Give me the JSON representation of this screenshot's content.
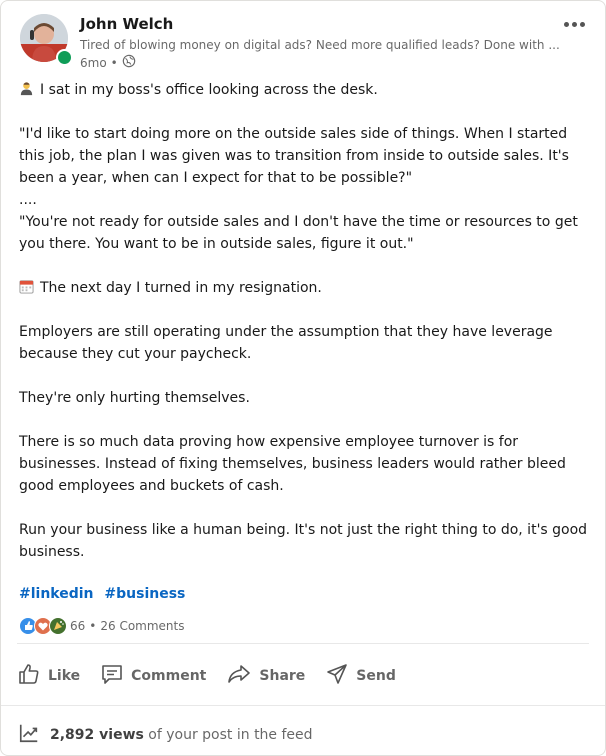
{
  "post": {
    "author_name": "John Welch",
    "author_headline": "Tired of blowing money on digital ads? Need more qualified leads? Done with ...",
    "age": "6mo",
    "meta_separator": "•",
    "body_paragraphs": [
      "I sat in my boss's office looking across the desk.",
      "\"I'd like to start doing more on the outside sales side of things. When I started this job, the plan I was given was to transition from inside to outside sales. It's been a year, when can I expect for that to be possible?\"",
      "....",
      "\"You're not ready for outside sales and I don't have the time or resources to get you there. You want to be in outside sales, figure it out.\"",
      "The next day I turned in my resignation.",
      "Employers are still operating under the assumption that they have leverage because they cut your paycheck.",
      "They're only hurting themselves.",
      "There is so much data proving how expensive employee turnover is for businesses. Instead of fixing themselves, business leaders would rather bleed good employees and buckets of cash.",
      "Run your business like a human being. It's not just the right thing to do, it's good business."
    ],
    "hashtags": [
      "#linkedin",
      "#business"
    ]
  },
  "social": {
    "reaction_count": "66",
    "separator": "•",
    "comments": "26 Comments",
    "reaction_colors": [
      "#378fe9",
      "#df704d",
      "#44712e"
    ]
  },
  "actions": {
    "like": "Like",
    "comment": "Comment",
    "share": "Share",
    "send": "Send"
  },
  "analytics": {
    "views_count": "2,892 views",
    "views_suffix": "of your post in the feed"
  },
  "icons": {
    "presence": "online-dot-icon",
    "visibility": "globe-icon",
    "person": "person-emoji-icon",
    "calendar": "calendar-emoji-icon",
    "stats": "trending-up-icon"
  }
}
